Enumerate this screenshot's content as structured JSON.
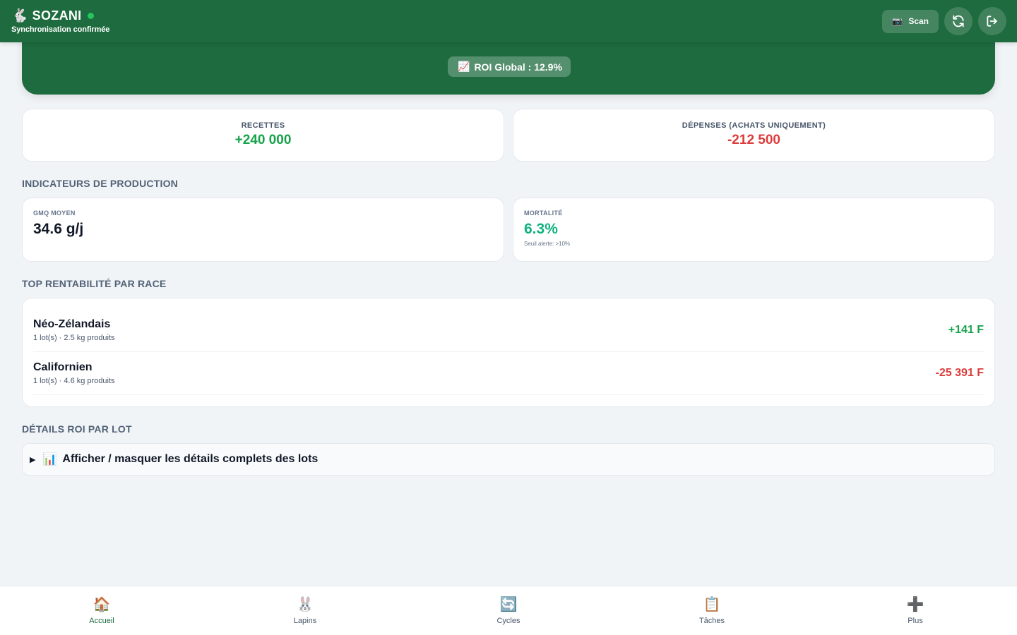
{
  "header": {
    "app_name": "SOZANI",
    "logo_icon": "🐇",
    "sync_status": "Synchronisation confirmée",
    "scan_icon": "📷",
    "scan_label": "Scan",
    "status_color": "#22c55e"
  },
  "hero": {
    "roi_icon": "📈",
    "roi_label": "ROI Global : 12.9%"
  },
  "summary": {
    "revenue_label": "RECETTES",
    "revenue_value": "+240 000",
    "expenses_label": "DÉPENSES (ACHATS UNIQUEMENT)",
    "expenses_value": "-212 500"
  },
  "production": {
    "title": "INDICATEURS DE PRODUCTION",
    "gmq_label": "GMQ MOYEN",
    "gmq_value": "34.6 g/j",
    "mortality_label": "MORTALITÉ",
    "mortality_value": "6.3%",
    "mortality_note": "Seuil alerte: >10%"
  },
  "top_race": {
    "title": "TOP RENTABILITÉ PAR RACE",
    "items": [
      {
        "name": "Néo-Zélandais",
        "meta": "1 lot(s) · 2.5 kg produits",
        "value": "+141 F"
      },
      {
        "name": "Californien",
        "meta": "1 lot(s) · 4.6 kg produits",
        "value": "-25 391 F"
      }
    ]
  },
  "details": {
    "title": "DÉTAILS ROI PAR LOT",
    "toggle_icon": "📊",
    "toggle_label": "Afficher / masquer les détails complets des lots"
  },
  "nav": {
    "items": [
      {
        "icon": "🏠",
        "label": "Accueil"
      },
      {
        "icon": "🐰",
        "label": "Lapins"
      },
      {
        "icon": "🔄",
        "label": "Cycles"
      },
      {
        "icon": "📋",
        "label": "Tâches"
      },
      {
        "icon": "➕",
        "label": "Plus"
      }
    ]
  },
  "colors": {
    "brand": "#1d6b3e",
    "positive": "#16a34a",
    "negative": "#dc3b3b",
    "teal": "#10b27f"
  }
}
